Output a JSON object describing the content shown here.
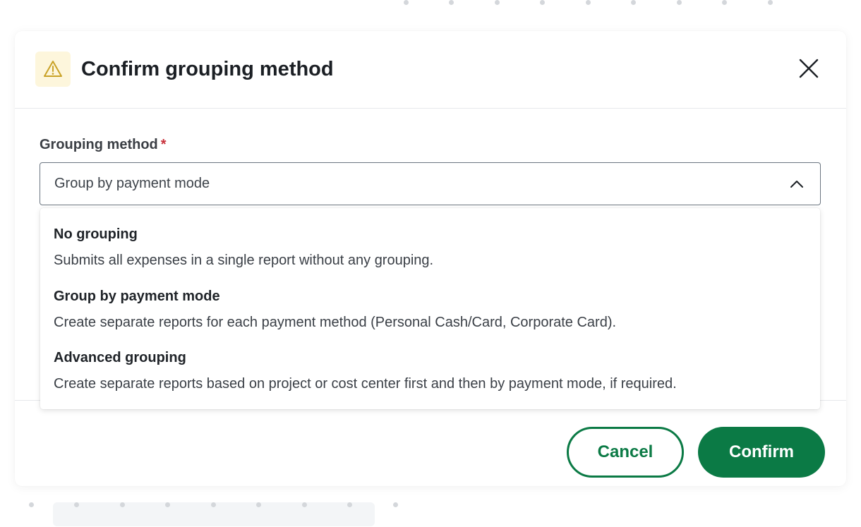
{
  "modal": {
    "title": "Confirm grouping method",
    "icon": "warning-icon",
    "accent_color": "#0b7a45",
    "warning_color": "#c9a227"
  },
  "field": {
    "label": "Grouping method",
    "required_mark": "*",
    "selected_value": "Group by payment mode"
  },
  "options": [
    {
      "title": "No grouping",
      "description": "Submits all expenses in a single report without any grouping."
    },
    {
      "title": "Group by payment mode",
      "description": "Create separate reports for each payment method (Personal Cash/Card, Corporate Card)."
    },
    {
      "title": "Advanced grouping",
      "description": "Create separate reports based on project or cost center first and then by payment mode, if required."
    }
  ],
  "footer": {
    "cancel_label": "Cancel",
    "confirm_label": "Confirm"
  }
}
